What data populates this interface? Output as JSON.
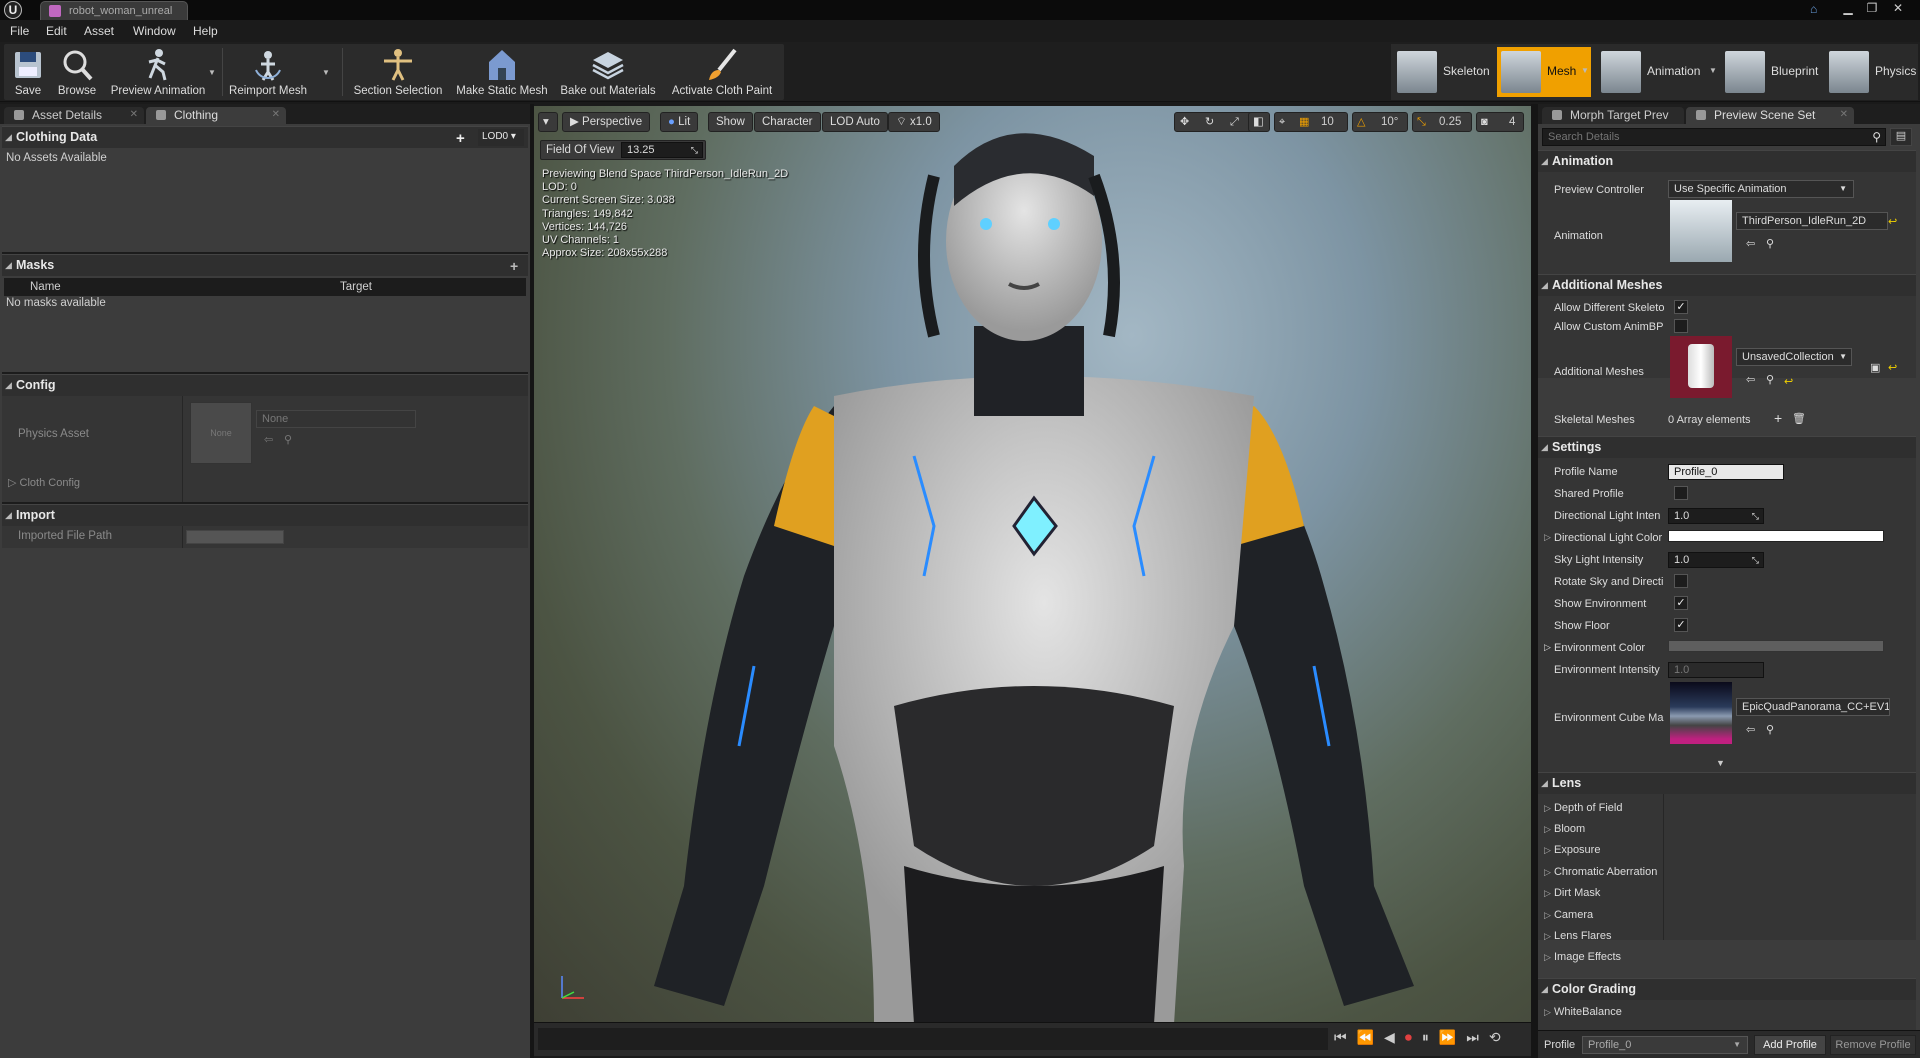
{
  "window": {
    "doc_tab": "robot_woman_unreal"
  },
  "menu": [
    "File",
    "Edit",
    "Asset",
    "Window",
    "Help"
  ],
  "toolbar": {
    "save": "Save",
    "browse": "Browse",
    "preview_animation": "Preview Animation",
    "reimport_mesh": "Reimport Mesh",
    "section_selection": "Section Selection",
    "make_static_mesh": "Make Static Mesh",
    "bake_out_materials": "Bake out Materials",
    "activate_cloth_paint": "Activate Cloth Paint"
  },
  "modes": {
    "skeleton": "Skeleton",
    "mesh": "Mesh",
    "animation": "Animation",
    "blueprint": "Blueprint",
    "physics": "Physics",
    "accent": "#f0a000"
  },
  "left_panel": {
    "tabs": [
      "Asset Details",
      "Clothing"
    ],
    "clothing_data": {
      "title": "Clothing Data",
      "lod": "LOD0",
      "empty": "No Assets Available"
    },
    "masks": {
      "title": "Masks",
      "col_name": "Name",
      "col_target": "Target",
      "empty": "No masks available"
    },
    "config": {
      "title": "Config",
      "physics_asset": "Physics Asset",
      "thumb_label": "None",
      "combo": "None",
      "cloth_config": "Cloth Config"
    },
    "import": {
      "title": "Import",
      "imported_file_path": "Imported File Path"
    }
  },
  "viewport": {
    "buttons": {
      "perspective": "Perspective",
      "lit": "Lit",
      "show": "Show",
      "character": "Character",
      "lod": "LOD Auto",
      "speed": "x1.0"
    },
    "fov_label": "Field Of View",
    "fov_value": "13.25",
    "stats": [
      "Previewing Blend Space ThirdPerson_IdleRun_2D",
      "LOD: 0",
      "Current Screen Size: 3.038",
      "Triangles: 149,842",
      "Vertices: 144,726",
      "UV Channels: 1",
      "Approx Size: 208x55x288"
    ],
    "right_tools": {
      "grid": "10",
      "angle": "10°",
      "scale": "0.25",
      "cam_speed": "4"
    }
  },
  "right_panel": {
    "tabs": [
      "Morph Target Prev",
      "Preview Scene Set"
    ],
    "search_placeholder": "Search Details",
    "animation": {
      "title": "Animation",
      "preview_controller": "Preview Controller",
      "preview_controller_value": "Use Specific Animation",
      "animation": "Animation",
      "animation_value": "ThirdPerson_IdleRun_2D"
    },
    "additional_meshes": {
      "title": "Additional Meshes",
      "allow_different": "Allow Different Skeleto",
      "allow_custom": "Allow Custom AnimBP",
      "additional_meshes": "Additional Meshes",
      "additional_value": "UnsavedCollection",
      "skeletal_meshes": "Skeletal Meshes",
      "skeletal_value": "0 Array elements"
    },
    "settings": {
      "title": "Settings",
      "profile_name": "Profile Name",
      "profile_value": "Profile_0",
      "shared_profile": "Shared Profile",
      "dir_light_int": "Directional Light Inten",
      "dir_light_int_value": "1.0",
      "dir_light_color": "Directional Light Color",
      "sky_light": "Sky Light Intensity",
      "sky_light_value": "1.0",
      "rotate_sky": "Rotate Sky and Directi",
      "show_env": "Show Environment",
      "show_floor": "Show Floor",
      "env_color": "Environment Color",
      "env_intensity": "Environment Intensity",
      "env_intensity_value": "1.0",
      "env_cube": "Environment Cube Ma",
      "env_cube_value": "EpicQuadPanorama_CC+EV1"
    },
    "lens": {
      "title": "Lens",
      "items": [
        "Depth of Field",
        "Bloom",
        "Exposure",
        "Chromatic Aberration",
        "Dirt Mask",
        "Camera",
        "Lens Flares",
        "Image Effects"
      ]
    },
    "color_grading": {
      "title": "Color Grading",
      "items": [
        "WhiteBalance"
      ]
    },
    "footer": {
      "profile_label": "Profile",
      "profile_value": "Profile_0",
      "add": "Add Profile",
      "remove": "Remove Profile"
    }
  }
}
